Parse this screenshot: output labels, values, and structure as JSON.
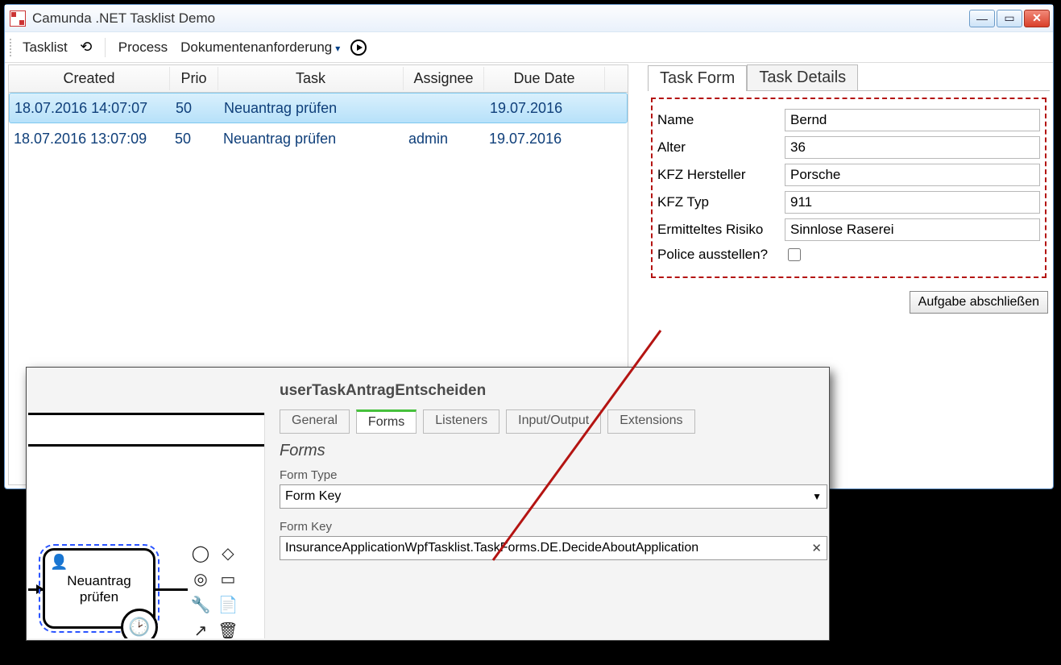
{
  "window": {
    "title": "Camunda .NET Tasklist Demo"
  },
  "menubar": {
    "tasklist": "Tasklist",
    "process": "Process",
    "process_value": "Dokumentenanforderung"
  },
  "grid": {
    "headers": {
      "created": "Created",
      "prio": "Prio",
      "task": "Task",
      "assignee": "Assignee",
      "due": "Due Date"
    },
    "rows": [
      {
        "created": "18.07.2016 14:07:07",
        "prio": "50",
        "task": "Neuantrag prüfen",
        "assignee": "",
        "due": "19.07.2016"
      },
      {
        "created": "18.07.2016 13:07:09",
        "prio": "50",
        "task": "Neuantrag prüfen",
        "assignee": "admin",
        "due": "19.07.2016"
      }
    ]
  },
  "tabs": {
    "form": "Task Form",
    "details": "Task Details"
  },
  "form": {
    "name_label": "Name",
    "name_value": "Bernd",
    "age_label": "Alter",
    "age_value": "36",
    "maker_label": "KFZ Hersteller",
    "maker_value": "Porsche",
    "type_label": "KFZ Typ",
    "type_value": "911",
    "risk_label": "Ermitteltes Risiko",
    "risk_value": "Sinnlose Raserei",
    "policy_label": "Police ausstellen?",
    "complete_button": "Aufgabe abschließen"
  },
  "props": {
    "title": "userTaskAntragEntscheiden",
    "tabs": {
      "general": "General",
      "forms": "Forms",
      "listeners": "Listeners",
      "io": "Input/Output",
      "ext": "Extensions"
    },
    "section": "Forms",
    "form_type_label": "Form Type",
    "form_type_value": "Form Key",
    "form_key_label": "Form Key",
    "form_key_value": "InsuranceApplicationWpfTasklist.TaskForms.DE.DecideAboutApplication",
    "bpmn_task_label": "Neuantrag\nprüfen"
  }
}
